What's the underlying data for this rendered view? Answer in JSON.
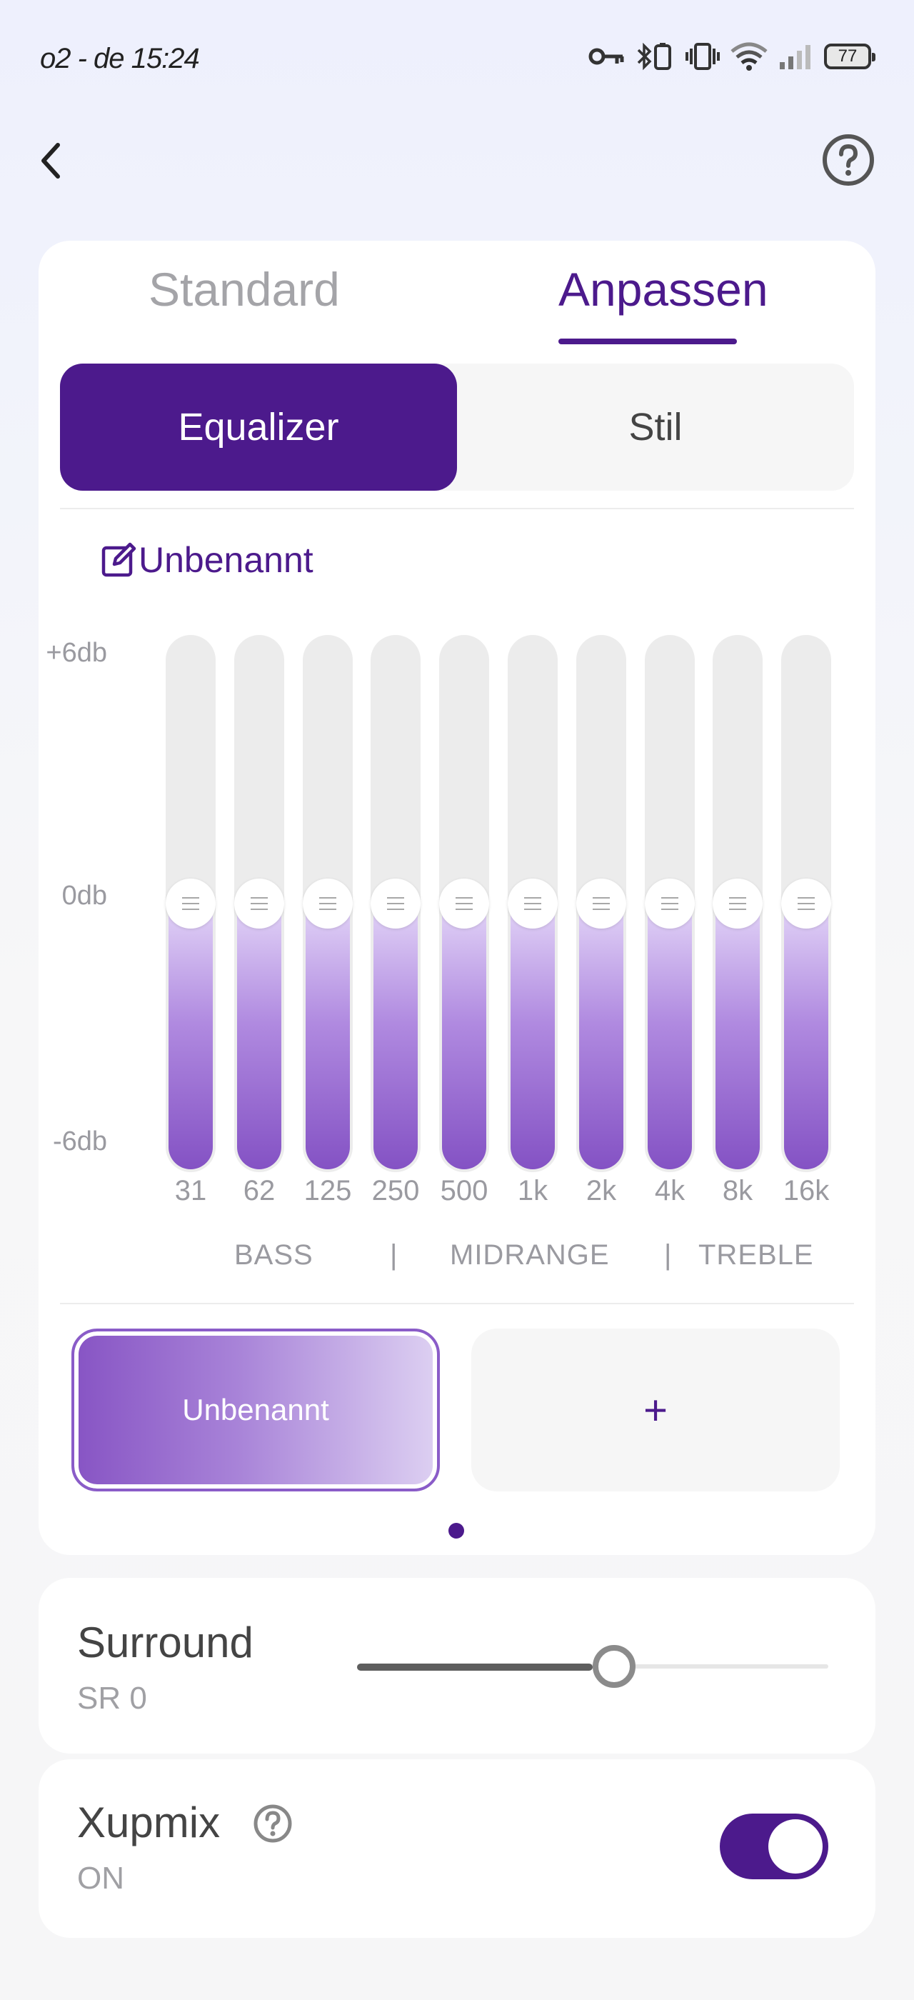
{
  "status_bar": {
    "time": "o2 - de 15:24",
    "battery_level": "77"
  },
  "tabs": [
    {
      "label": "Standard",
      "active": false
    },
    {
      "label": "Anpassen",
      "active": true
    }
  ],
  "segment": {
    "equalizer_label": "Equalizer",
    "stil_label": "Stil",
    "selected": "Equalizer"
  },
  "preset_name": "Unbenannt",
  "db_scale": {
    "max": "+6db",
    "mid": "0db",
    "min": "-6db"
  },
  "bands": [
    {
      "freq": "31",
      "gain_db": 0
    },
    {
      "freq": "62",
      "gain_db": 0
    },
    {
      "freq": "125",
      "gain_db": 0
    },
    {
      "freq": "250",
      "gain_db": 0
    },
    {
      "freq": "500",
      "gain_db": 0
    },
    {
      "freq": "1k",
      "gain_db": 0
    },
    {
      "freq": "2k",
      "gain_db": 0
    },
    {
      "freq": "4k",
      "gain_db": 0
    },
    {
      "freq": "8k",
      "gain_db": 0
    },
    {
      "freq": "16k",
      "gain_db": 0
    }
  ],
  "ranges": {
    "bass": "BASS",
    "sep1": "|",
    "midrange": "MIDRANGE",
    "sep2": "|",
    "treble": "TREBLE"
  },
  "presets": {
    "active_label": "Unbenannt",
    "add_label": "+"
  },
  "surround": {
    "title": "Surround",
    "value": "SR 0",
    "slider_fraction": 0.5
  },
  "xupmix": {
    "title": "Xupmix",
    "state": "ON",
    "enabled": true
  },
  "colors": {
    "accent": "#4c1a8c",
    "band_fill_top": "#e2d4f7",
    "band_fill_bottom": "#8452c4"
  },
  "icons": {
    "back": "chevron-left-icon",
    "help": "question-circle-icon",
    "edit": "edit-icon"
  }
}
